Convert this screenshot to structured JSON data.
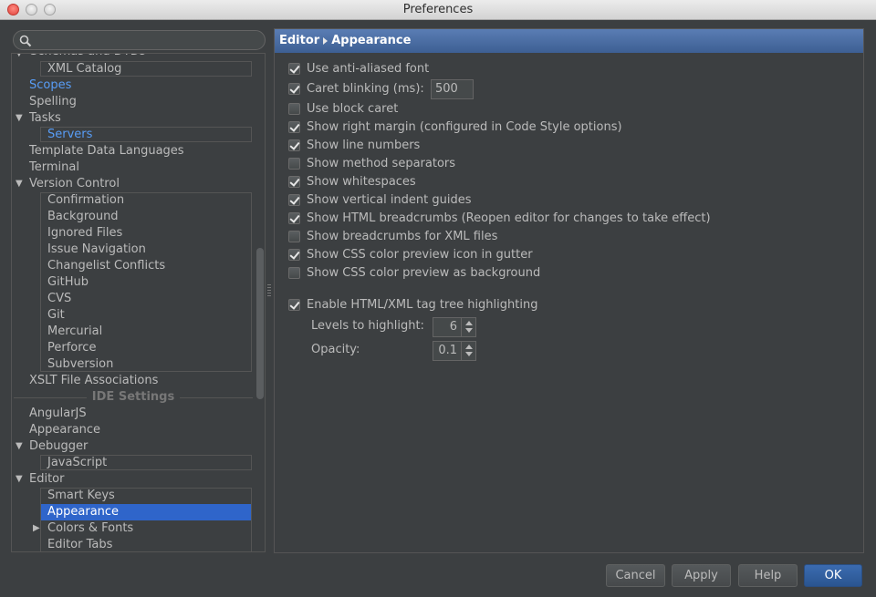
{
  "window": {
    "title": "Preferences"
  },
  "search": {
    "placeholder": ""
  },
  "tree": {
    "top_cut_label": "Schemas and DTDs",
    "items": [
      {
        "label": "XML Catalog",
        "style": "boxed"
      },
      {
        "label": "Scopes",
        "style": "link"
      },
      {
        "label": "Spelling",
        "style": "normal"
      },
      {
        "label": "Tasks",
        "style": "expandable",
        "expanded": true
      },
      {
        "label": "Servers",
        "style": "boxed-link"
      },
      {
        "label": "Template Data Languages",
        "style": "normal"
      },
      {
        "label": "Terminal",
        "style": "normal"
      },
      {
        "label": "Version Control",
        "style": "expandable",
        "expanded": true
      },
      {
        "label": "Confirmation"
      },
      {
        "label": "Background"
      },
      {
        "label": "Ignored Files"
      },
      {
        "label": "Issue Navigation"
      },
      {
        "label": "Changelist Conflicts"
      },
      {
        "label": "GitHub"
      },
      {
        "label": "CVS"
      },
      {
        "label": "Git"
      },
      {
        "label": "Mercurial"
      },
      {
        "label": "Perforce"
      },
      {
        "label": "Subversion"
      },
      {
        "label": "XSLT File Associations"
      }
    ],
    "ide_section_label": "IDE Settings",
    "ide_items": [
      {
        "label": "AngularJS"
      },
      {
        "label": "Appearance"
      },
      {
        "label": "Debugger",
        "expanded": true
      },
      {
        "label": "JavaScript"
      },
      {
        "label": "Editor",
        "expanded": true
      },
      {
        "label": "Smart Keys"
      },
      {
        "label": "Appearance",
        "selected": true
      },
      {
        "label": "Colors & Fonts",
        "expanded": false
      },
      {
        "label": "Editor Tabs"
      }
    ]
  },
  "breadcrumb": {
    "parent": "Editor",
    "current": "Appearance"
  },
  "options": [
    {
      "label": "Use anti-aliased font",
      "checked": true
    },
    {
      "label": "Caret blinking (ms):",
      "checked": true
    },
    {
      "label": "Use block caret",
      "checked": false
    },
    {
      "label": "Show right margin (configured in Code Style options)",
      "checked": true
    },
    {
      "label": "Show line numbers",
      "checked": true
    },
    {
      "label": "Show method separators",
      "checked": false
    },
    {
      "label": "Show whitespaces",
      "checked": true
    },
    {
      "label": "Show vertical indent guides",
      "checked": true
    },
    {
      "label": "Show HTML breadcrumbs (Reopen editor for changes to take effect)",
      "checked": true
    },
    {
      "label": "Show breadcrumbs for XML files",
      "checked": false
    },
    {
      "label": "Show CSS color preview icon in gutter",
      "checked": true
    },
    {
      "label": "Show CSS color preview as background",
      "checked": false
    },
    {
      "label": "Enable HTML/XML tag tree highlighting",
      "checked": true
    }
  ],
  "caret_blinking_value": "500",
  "levels": {
    "label": "Levels to highlight:",
    "value": "6"
  },
  "opacity": {
    "label": "Opacity:",
    "value": "0.1"
  },
  "buttons": {
    "cancel": "Cancel",
    "apply": "Apply",
    "help": "Help",
    "ok": "OK"
  },
  "colors": {
    "selection": "#2f65ca",
    "link": "#589df6",
    "background": "#3c3f41",
    "breadcrumb": "#4a6ea5"
  }
}
